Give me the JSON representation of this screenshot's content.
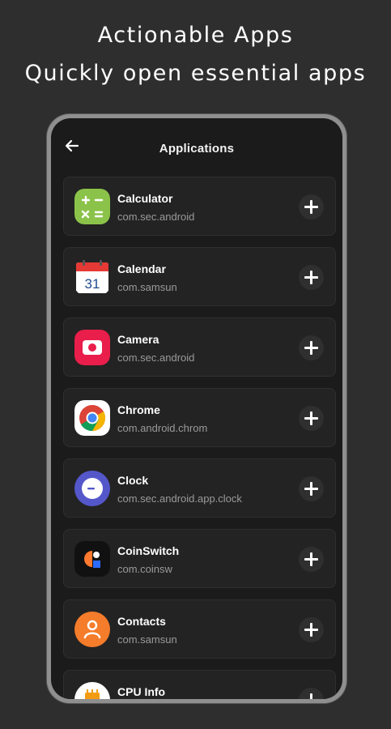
{
  "promo": {
    "headline": "Actionable Apps",
    "subheadline": "Quickly open essential apps"
  },
  "screen": {
    "title": "Applications",
    "back_icon": "arrow-left-icon"
  },
  "apps": [
    {
      "name": "Calculator",
      "package": "com.sec.android",
      "icon": "calculator-icon",
      "color": "#8bc34a"
    },
    {
      "name": "Calendar",
      "package": "com.samsun",
      "icon": "calendar-icon",
      "color": "#e53935"
    },
    {
      "name": "Camera",
      "package": "com.sec.android",
      "icon": "camera-icon",
      "color": "#e91e4b"
    },
    {
      "name": "Chrome",
      "package": "com.android.chrom",
      "icon": "chrome-icon",
      "color": "#ffffff"
    },
    {
      "name": "Clock",
      "package": "com.sec.android.app.clock",
      "icon": "clock-icon",
      "color": "#5457c9"
    },
    {
      "name": "CoinSwitch",
      "package": "com.coinsw",
      "icon": "coinswitch-icon",
      "color": "#111111"
    },
    {
      "name": "Contacts",
      "package": "com.samsun",
      "icon": "contacts-icon",
      "color": "#f57c2a"
    },
    {
      "name": "CPU Info",
      "package": "",
      "icon": "cpu-info-icon",
      "color": "#ffffff"
    }
  ],
  "add_button_icon": "plus-icon"
}
